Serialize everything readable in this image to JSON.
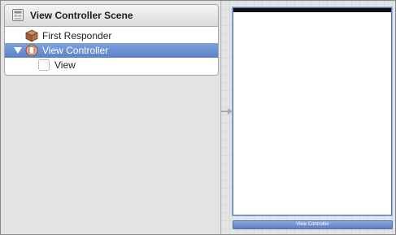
{
  "outline": {
    "scene_title": "View Controller Scene",
    "items": [
      {
        "label": "First Responder",
        "icon": "first-responder-cube-icon",
        "selected": false
      },
      {
        "label": "View Controller",
        "icon": "view-controller-icon",
        "selected": true
      },
      {
        "label": "View",
        "icon": "view-icon",
        "selected": false
      }
    ]
  },
  "canvas": {
    "dock_label": "View Controller"
  },
  "colors": {
    "selection": "#5a82c9",
    "device_border": "#4f73b8",
    "status_bar": "#111111"
  }
}
